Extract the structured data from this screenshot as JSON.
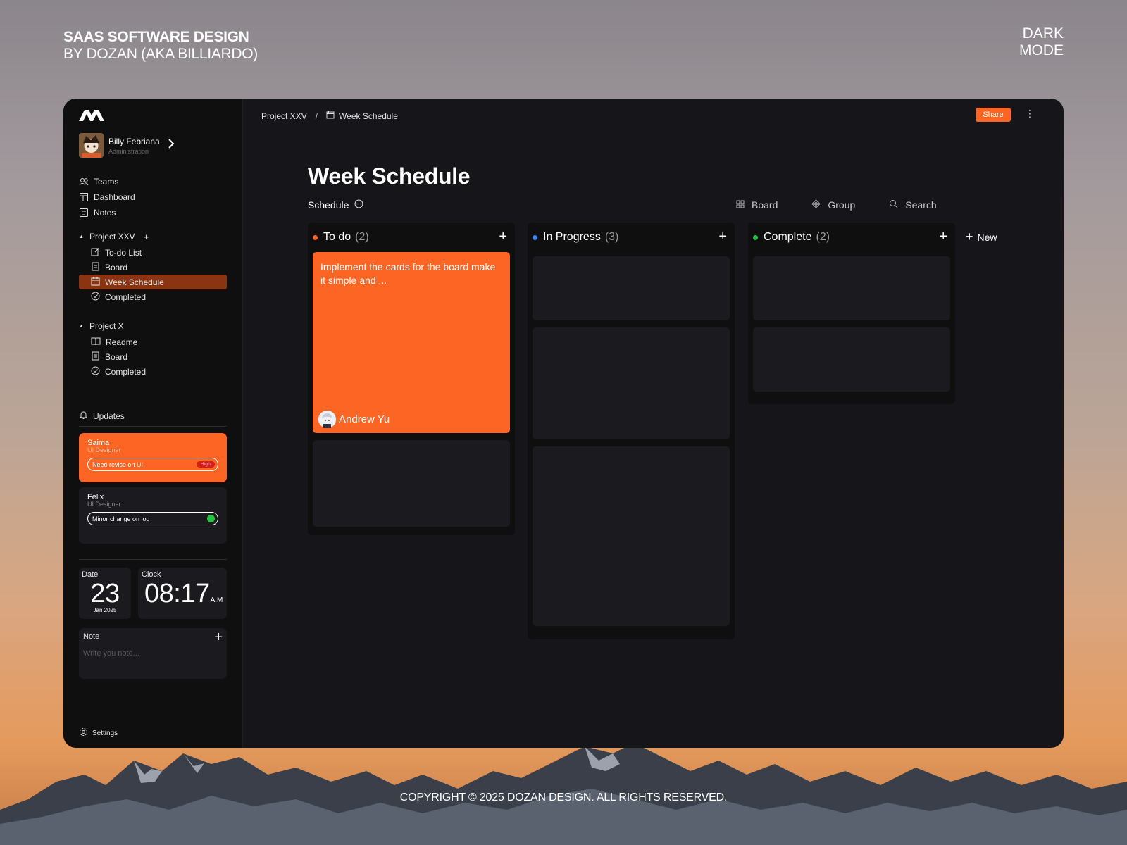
{
  "header": {
    "title_line1": "SAAS SOFTWARE DESIGN",
    "title_line2": "BY DOZAN (AKA BILLIARDO)",
    "mode_line1": "DARK",
    "mode_line2": "MODE"
  },
  "footer": {
    "copyright": "COPYRIGHT © 2025 DOZAN DESIGN. ALL RIGHTS RESERVED."
  },
  "colors": {
    "accent": "#fd6524",
    "todo": "#fd6524",
    "progress": "#3b82f6",
    "complete": "#22c43f"
  },
  "sidebar": {
    "user": {
      "name": "Billy Febriana",
      "role": "Administration"
    },
    "nav": [
      {
        "label": "Teams",
        "icon": "users-icon"
      },
      {
        "label": "Dashboard",
        "icon": "dashboard-icon"
      },
      {
        "label": "Notes",
        "icon": "notes-icon"
      }
    ],
    "project1": {
      "title": "Project XXV",
      "items": [
        {
          "label": "To-do List",
          "icon": "edit-icon"
        },
        {
          "label": "Board",
          "icon": "board-icon"
        },
        {
          "label": "Week Schedule",
          "icon": "calendar-icon",
          "active": true
        },
        {
          "label": "Completed",
          "icon": "check-circle-icon"
        }
      ]
    },
    "project2": {
      "title": "Project X",
      "items": [
        {
          "label": "Readme",
          "icon": "book-icon"
        },
        {
          "label": "Board",
          "icon": "board-icon"
        },
        {
          "label": "Completed",
          "icon": "check-circle-icon"
        }
      ]
    },
    "updates": {
      "title": "Updates",
      "cards": [
        {
          "name": "Saima",
          "role": "UI Designer",
          "message": "Need revise on UI",
          "priority": "High"
        },
        {
          "name": "Felix",
          "role": "UI Designer",
          "message": "Minor change on log"
        }
      ]
    },
    "date": {
      "label": "Date",
      "day": "23",
      "month_year": "Jan 2025"
    },
    "clock": {
      "label": "Clock",
      "time": "08:17",
      "ampm": "A.M"
    },
    "note": {
      "label": "Note",
      "placeholder": "Write you note..."
    },
    "settings": "Settings"
  },
  "main": {
    "breadcrumb": {
      "project": "Project XXV",
      "separator": "/",
      "page": "Week Schedule"
    },
    "share_label": "Share",
    "title": "Week Schedule",
    "view_tab": "Schedule",
    "toolbar": {
      "board": "Board",
      "group": "Group",
      "search": "Search"
    },
    "new_label": "New",
    "columns": [
      {
        "title": "To do",
        "count": "(2)",
        "cards": [
          {
            "text": "Implement the cards for the board make it simple and ...",
            "assignee": "Andrew Yu",
            "highlight": true
          },
          {
            "text": ""
          }
        ]
      },
      {
        "title": "In Progress",
        "count": "(3)",
        "cards": [
          {},
          {},
          {}
        ]
      },
      {
        "title": "Complete",
        "count": "(2)",
        "cards": [
          {},
          {}
        ]
      }
    ]
  }
}
